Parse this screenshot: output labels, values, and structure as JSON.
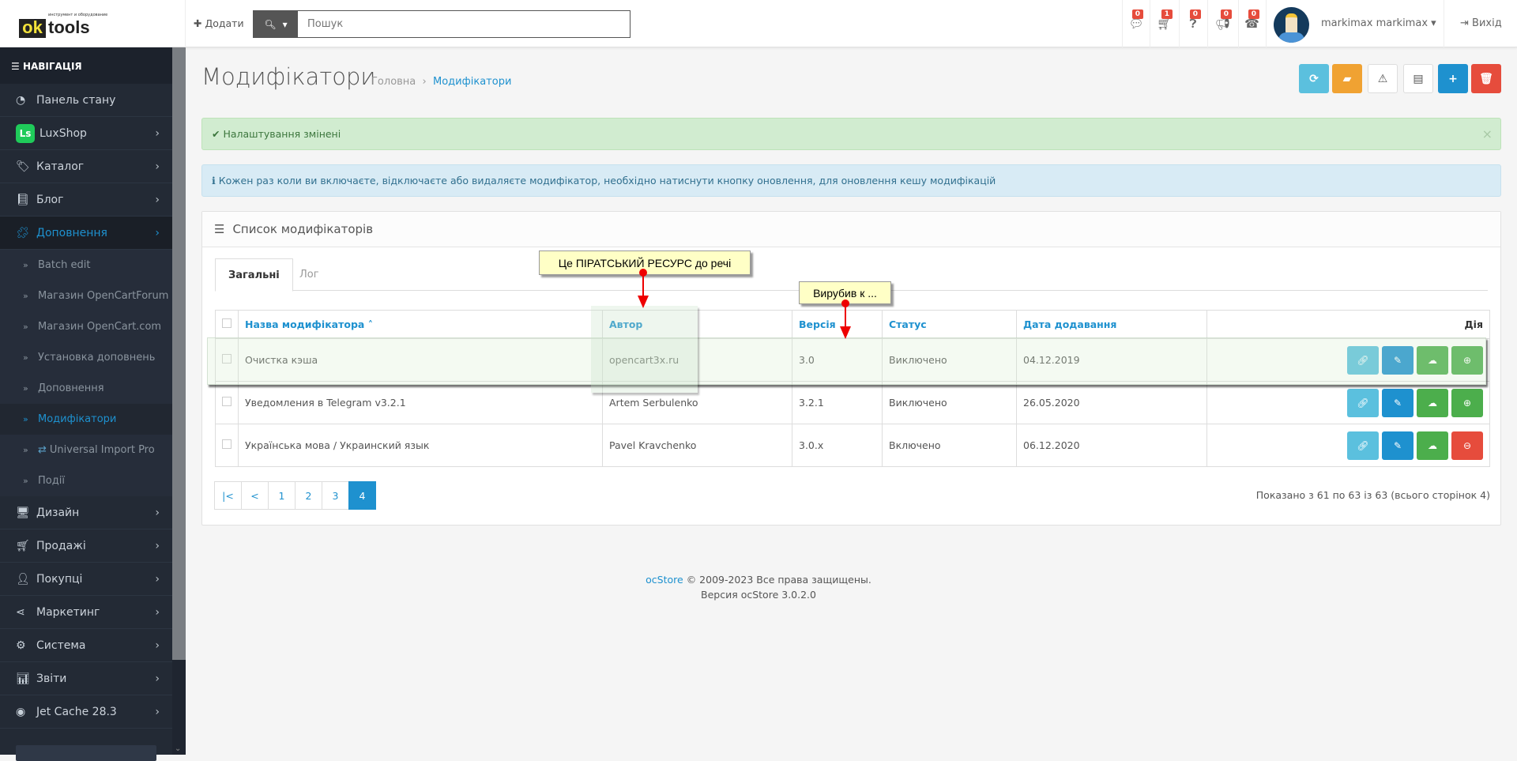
{
  "header": {
    "logo": {
      "ok": "ok",
      "tools": "tools",
      "tagline": "инструмент и оборудование"
    },
    "add_label": "Додати",
    "search_placeholder": "Пошук",
    "notifications": [
      {
        "icon": "comment-icon",
        "count": "0"
      },
      {
        "icon": "cart-icon",
        "count": "1"
      },
      {
        "icon": "question-icon",
        "count": "0"
      },
      {
        "icon": "bullhorn-icon",
        "count": "0"
      },
      {
        "icon": "phone-icon",
        "count": "0"
      }
    ],
    "username": "markimax markimax",
    "logout_label": "Вихід"
  },
  "sidebar": {
    "title": "НАВІГАЦІЯ",
    "items": [
      {
        "label": "Панель стану"
      },
      {
        "label": "LuxShop"
      },
      {
        "label": "Каталог"
      },
      {
        "label": "Блог"
      },
      {
        "label": "Доповнення"
      }
    ],
    "sub_items": [
      {
        "label": "Batch edit"
      },
      {
        "label": "Магазин OpenCartForum"
      },
      {
        "label": "Магазин OpenCart.com"
      },
      {
        "label": "Установка доповнень"
      },
      {
        "label": "Доповнення"
      },
      {
        "label": "Модифікатори"
      },
      {
        "label": "Universal Import Pro"
      },
      {
        "label": "Події"
      }
    ],
    "items_after": [
      {
        "label": "Дизайн"
      },
      {
        "label": "Продажі"
      },
      {
        "label": "Покупці"
      },
      {
        "label": "Маркетинг"
      },
      {
        "label": "Система"
      },
      {
        "label": "Звіти"
      },
      {
        "label": "Jet Cache 28.3"
      }
    ]
  },
  "page": {
    "title": "Модифікатори",
    "breadcrumb": [
      "Головна",
      "Модифікатори"
    ],
    "alert_success": "Налаштування змінені",
    "alert_info": "Кожен раз коли ви включаєте, відключаєте або видаляєте модифікатор, необхідно натиснути кнопку оновлення, для оновлення кешу модифікацій",
    "colors": {
      "primary": "#1e91cf",
      "info": "#5bc0de",
      "warning": "#f0a232",
      "success": "#4cae4c",
      "danger": "#e64c3c"
    }
  },
  "panel": {
    "title": "Список модифікаторів",
    "tabs": [
      "Загальні",
      "Лог"
    ],
    "columns": [
      "Назва модифікатора",
      "Автор",
      "Версія",
      "Статус",
      "Дата додавання",
      "Дія"
    ],
    "rows": [
      {
        "name": "Очистка кэша",
        "author": "opencart3x.ru",
        "version": "3.0",
        "status": "Виключено",
        "date": "04.12.2019",
        "toggle": "enable"
      },
      {
        "name": "Уведомления в Telegram v3.2.1",
        "author": "Artem Serbulenko",
        "version": "3.2.1",
        "status": "Виключено",
        "date": "26.05.2020",
        "toggle": "enable"
      },
      {
        "name": "Українська мова / Украинский язык",
        "author": "Pavel Kravchenko",
        "version": "3.0.x",
        "status": "Включено",
        "date": "06.12.2020",
        "toggle": "disable"
      }
    ],
    "pagination": [
      "|<",
      "<",
      "1",
      "2",
      "3",
      "4"
    ],
    "current_page": "4",
    "pagination_info": "Показано з 61 по 63 із 63 (всього сторінок 4)"
  },
  "footer": {
    "brand": "ocStore",
    "copyright": "© 2009-2023 Все права защищены.",
    "version": "Версия ocStore 3.0.2.0"
  },
  "annotations": {
    "callout1": "Це ПІРАТСЬКИЙ РЕСУРС до речі",
    "callout2": "Вирубив к ..."
  }
}
